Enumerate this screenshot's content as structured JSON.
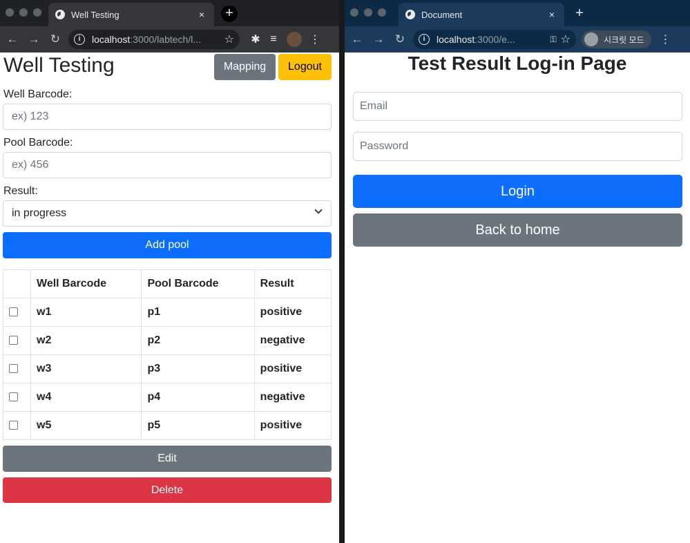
{
  "left_window": {
    "tab": {
      "title": "Well Testing",
      "close": "×"
    },
    "new_tab": "+",
    "url": {
      "host": "localhost",
      "path": ":3000/labtech/l..."
    },
    "page": {
      "title": "Well Testing",
      "mapping_label": "Mapping",
      "logout_label": "Logout",
      "well_barcode_label": "Well Barcode:",
      "well_barcode_placeholder": "ex) 123",
      "pool_barcode_label": "Pool Barcode:",
      "pool_barcode_placeholder": "ex) 456",
      "result_label": "Result:",
      "result_selected": "in progress",
      "add_pool_label": "Add pool",
      "table": {
        "headers": [
          "",
          "Well Barcode",
          "Pool Barcode",
          "Result"
        ],
        "rows": [
          {
            "well": "w1",
            "pool": "p1",
            "result": "positive"
          },
          {
            "well": "w2",
            "pool": "p2",
            "result": "negative"
          },
          {
            "well": "w3",
            "pool": "p3",
            "result": "positive"
          },
          {
            "well": "w4",
            "pool": "p4",
            "result": "negative"
          },
          {
            "well": "w5",
            "pool": "p5",
            "result": "positive"
          }
        ]
      },
      "edit_label": "Edit",
      "delete_label": "Delete"
    }
  },
  "right_window": {
    "tab": {
      "title": "Document",
      "close": "×"
    },
    "new_tab": "+",
    "url": {
      "host": "localhost",
      "path": ":3000/e..."
    },
    "incognito_label": "시크릿 모드",
    "page": {
      "title": "Test Result Log-in Page",
      "email_placeholder": "Email",
      "password_placeholder": "Password",
      "login_label": "Login",
      "back_label": "Back to home"
    }
  },
  "colors": {
    "primary": "#0d6efd",
    "secondary": "#6c757d",
    "warning": "#ffc107",
    "danger": "#dc3545"
  }
}
